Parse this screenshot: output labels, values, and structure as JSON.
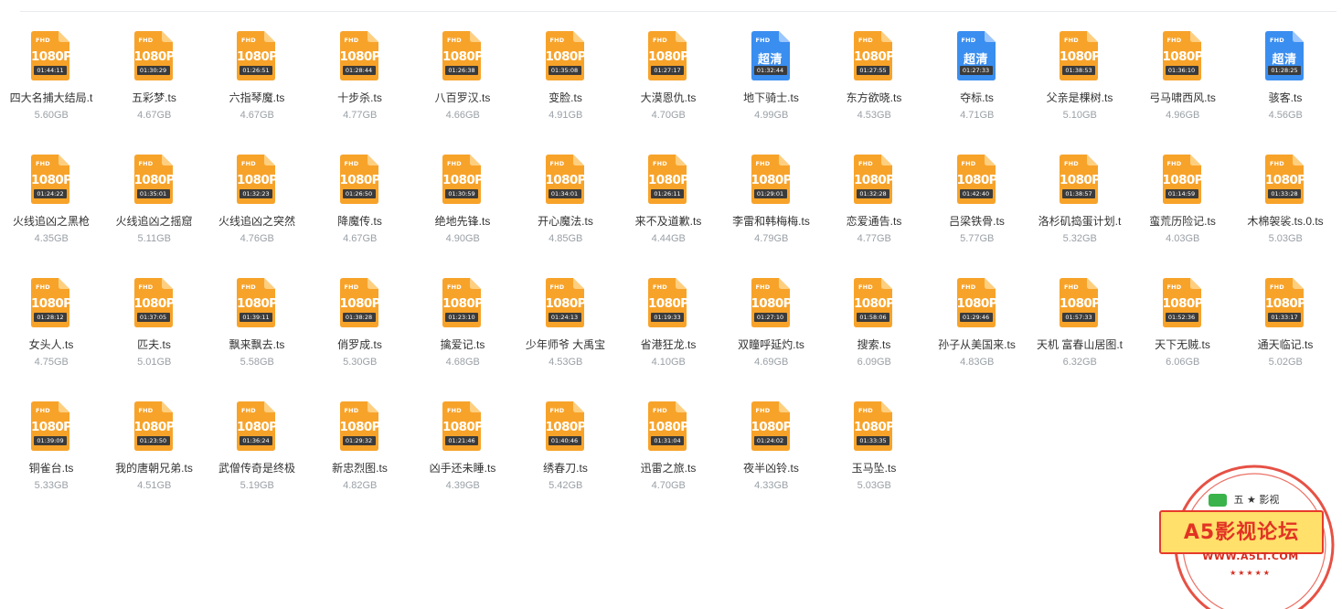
{
  "colors": {
    "orange": "#f7a32a",
    "orange_fold": "#ffcf80",
    "blue": "#3a8ef0",
    "blue_fold": "#9cc6ff",
    "dark_label": "#3b3b3b"
  },
  "files": [
    {
      "name": "四大名捕大结局.t",
      "size": "5.60GB",
      "badge": "FHD",
      "res": "1080P",
      "dur": "01:44:11",
      "color": "orange"
    },
    {
      "name": "五彩梦.ts",
      "size": "4.67GB",
      "badge": "FHD",
      "res": "1080P",
      "dur": "01:30:29",
      "color": "orange"
    },
    {
      "name": "六指琴魔.ts",
      "size": "4.67GB",
      "badge": "FHD",
      "res": "1080P",
      "dur": "01:26:51",
      "color": "orange"
    },
    {
      "name": "十步杀.ts",
      "size": "4.77GB",
      "badge": "FHD",
      "res": "1080P",
      "dur": "01:28:44",
      "color": "orange"
    },
    {
      "name": "八百罗汉.ts",
      "size": "4.66GB",
      "badge": "FHD",
      "res": "1080P",
      "dur": "01:26:38",
      "color": "orange"
    },
    {
      "name": "变脸.ts",
      "size": "4.91GB",
      "badge": "FHD",
      "res": "1080P",
      "dur": "01:35:08",
      "color": "orange"
    },
    {
      "name": "大漠恩仇.ts",
      "size": "4.70GB",
      "badge": "FHD",
      "res": "1080P",
      "dur": "01:27:17",
      "color": "orange"
    },
    {
      "name": "地下骑士.ts",
      "size": "4.99GB",
      "badge": "FHD",
      "res": "超清",
      "dur": "01:32:44",
      "color": "blue"
    },
    {
      "name": "东方欲晓.ts",
      "size": "4.53GB",
      "badge": "FHD",
      "res": "1080P",
      "dur": "01:27:55",
      "color": "orange"
    },
    {
      "name": "夺标.ts",
      "size": "4.71GB",
      "badge": "FHD",
      "res": "超清",
      "dur": "01:27:33",
      "color": "blue"
    },
    {
      "name": "父亲是棵树.ts",
      "size": "5.10GB",
      "badge": "FHD",
      "res": "1080P",
      "dur": "01:38:53",
      "color": "orange"
    },
    {
      "name": "弓马啸西风.ts",
      "size": "4.96GB",
      "badge": "FHD",
      "res": "1080P",
      "dur": "01:36:10",
      "color": "orange"
    },
    {
      "name": "骇客.ts",
      "size": "4.56GB",
      "badge": "FHD",
      "res": "超清",
      "dur": "01:28:25",
      "color": "blue"
    },
    {
      "name": "火线追凶之黑枪",
      "size": "4.35GB",
      "badge": "FHD",
      "res": "1080P",
      "dur": "01:24:22",
      "color": "orange"
    },
    {
      "name": "火线追凶之摇窟",
      "size": "5.11GB",
      "badge": "FHD",
      "res": "1080P",
      "dur": "01:35:01",
      "color": "orange"
    },
    {
      "name": "火线追凶之突然",
      "size": "4.76GB",
      "badge": "FHD",
      "res": "1080P",
      "dur": "01:32:23",
      "color": "orange"
    },
    {
      "name": "降魔传.ts",
      "size": "4.67GB",
      "badge": "FHD",
      "res": "1080P",
      "dur": "01:26:50",
      "color": "orange"
    },
    {
      "name": "绝地先锋.ts",
      "size": "4.90GB",
      "badge": "FHD",
      "res": "1080P",
      "dur": "01:30:59",
      "color": "orange"
    },
    {
      "name": "开心魔法.ts",
      "size": "4.85GB",
      "badge": "FHD",
      "res": "1080P",
      "dur": "01:34:01",
      "color": "orange"
    },
    {
      "name": "来不及道歉.ts",
      "size": "4.44GB",
      "badge": "FHD",
      "res": "1080P",
      "dur": "01:26:11",
      "color": "orange"
    },
    {
      "name": "李雷和韩梅梅.ts",
      "size": "4.79GB",
      "badge": "FHD",
      "res": "1080P",
      "dur": "01:29:01",
      "color": "orange"
    },
    {
      "name": "恋爱通告.ts",
      "size": "4.77GB",
      "badge": "FHD",
      "res": "1080P",
      "dur": "01:32:28",
      "color": "orange"
    },
    {
      "name": "吕梁铁骨.ts",
      "size": "5.77GB",
      "badge": "FHD",
      "res": "1080P",
      "dur": "01:42:40",
      "color": "orange"
    },
    {
      "name": "洛杉矶捣蛋计划.t",
      "size": "5.32GB",
      "badge": "FHD",
      "res": "1080P",
      "dur": "01:38:57",
      "color": "orange"
    },
    {
      "name": "蛮荒历险记.ts",
      "size": "4.03GB",
      "badge": "FHD",
      "res": "1080P",
      "dur": "01:14:59",
      "color": "orange"
    },
    {
      "name": "木棉袈裟.ts.0.ts",
      "size": "5.03GB",
      "badge": "FHD",
      "res": "1080P",
      "dur": "01:33:28",
      "color": "orange"
    },
    {
      "name": "女头人.ts",
      "size": "4.75GB",
      "badge": "FHD",
      "res": "1080P",
      "dur": "01:28:12",
      "color": "orange"
    },
    {
      "name": "匹夫.ts",
      "size": "5.01GB",
      "badge": "FHD",
      "res": "1080P",
      "dur": "01:37:05",
      "color": "orange"
    },
    {
      "name": "飘来飘去.ts",
      "size": "5.58GB",
      "badge": "FHD",
      "res": "1080P",
      "dur": "01:39:11",
      "color": "orange"
    },
    {
      "name": "俏罗成.ts",
      "size": "5.30GB",
      "badge": "FHD",
      "res": "1080P",
      "dur": "01:38:28",
      "color": "orange"
    },
    {
      "name": "擒爱记.ts",
      "size": "4.68GB",
      "badge": "FHD",
      "res": "1080P",
      "dur": "01:23:10",
      "color": "orange"
    },
    {
      "name": "少年师爷 大禹宝",
      "size": "4.53GB",
      "badge": "FHD",
      "res": "1080P",
      "dur": "01:24:13",
      "color": "orange"
    },
    {
      "name": "省港狂龙.ts",
      "size": "4.10GB",
      "badge": "FHD",
      "res": "1080P",
      "dur": "01:19:33",
      "color": "orange"
    },
    {
      "name": "双瞳呼延灼.ts",
      "size": "4.69GB",
      "badge": "FHD",
      "res": "1080P",
      "dur": "01:27:10",
      "color": "orange"
    },
    {
      "name": "搜索.ts",
      "size": "6.09GB",
      "badge": "FHD",
      "res": "1080P",
      "dur": "01:58:06",
      "color": "orange"
    },
    {
      "name": "孙子从美国来.ts",
      "size": "4.83GB",
      "badge": "FHD",
      "res": "1080P",
      "dur": "01:29:46",
      "color": "orange"
    },
    {
      "name": "天机 富春山居图.t",
      "size": "6.32GB",
      "badge": "FHD",
      "res": "1080P",
      "dur": "01:57:33",
      "color": "orange"
    },
    {
      "name": "天下无贼.ts",
      "size": "6.06GB",
      "badge": "FHD",
      "res": "1080P",
      "dur": "01:52:36",
      "color": "orange"
    },
    {
      "name": "通天临记.ts",
      "size": "5.02GB",
      "badge": "FHD",
      "res": "1080P",
      "dur": "01:33:17",
      "color": "orange"
    },
    {
      "name": "铜雀台.ts",
      "size": "5.33GB",
      "badge": "FHD",
      "res": "1080P",
      "dur": "01:39:09",
      "color": "orange"
    },
    {
      "name": "我的唐朝兄弟.ts",
      "size": "4.51GB",
      "badge": "FHD",
      "res": "1080P",
      "dur": "01:23:50",
      "color": "orange"
    },
    {
      "name": "武僧传奇是终极",
      "size": "5.19GB",
      "badge": "FHD",
      "res": "1080P",
      "dur": "01:36:24",
      "color": "orange"
    },
    {
      "name": "新忠烈图.ts",
      "size": "4.82GB",
      "badge": "FHD",
      "res": "1080P",
      "dur": "01:29:32",
      "color": "orange"
    },
    {
      "name": "凶手还未睡.ts",
      "size": "4.39GB",
      "badge": "FHD",
      "res": "1080P",
      "dur": "01:21:46",
      "color": "orange"
    },
    {
      "name": "绣春刀.ts",
      "size": "5.42GB",
      "badge": "FHD",
      "res": "1080P",
      "dur": "01:40:46",
      "color": "orange"
    },
    {
      "name": "迅雷之旅.ts",
      "size": "4.70GB",
      "badge": "FHD",
      "res": "1080P",
      "dur": "01:31:04",
      "color": "orange"
    },
    {
      "name": "夜半凶铃.ts",
      "size": "4.33GB",
      "badge": "FHD",
      "res": "1080P",
      "dur": "01:24:02",
      "color": "orange"
    },
    {
      "name": "玉马坠.ts",
      "size": "5.03GB",
      "badge": "FHD",
      "res": "1080P",
      "dur": "01:33:35",
      "color": "orange"
    }
  ],
  "watermark": {
    "title": "A5影视论坛",
    "url": "WWW.A5LT.COM",
    "stars": "★★★★★",
    "toolbar_text": "五 ★ 影视"
  }
}
